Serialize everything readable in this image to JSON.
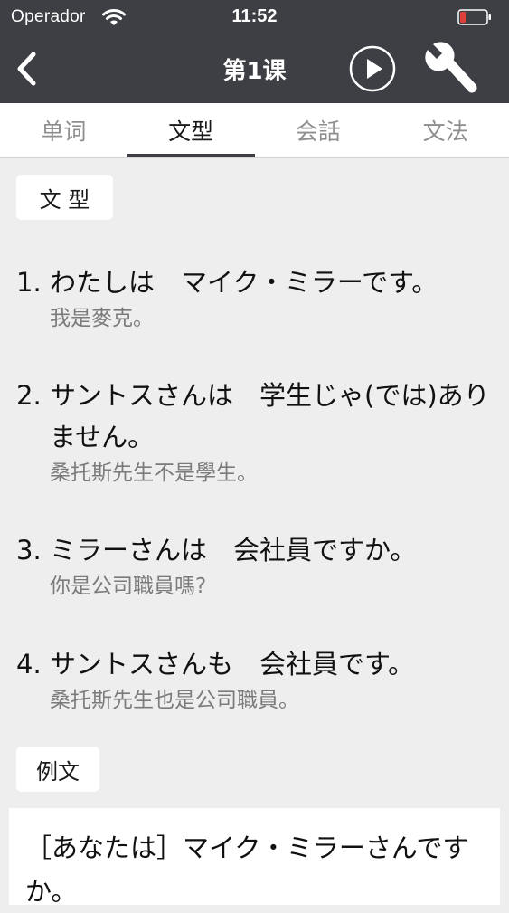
{
  "status_bar": {
    "carrier": "Operador",
    "time": "11:52",
    "battery_color": "#e0403a"
  },
  "nav": {
    "title": "第1课",
    "back_icon": "chevron-left-icon",
    "play_icon": "play-circle-icon",
    "settings_icon": "wrench-icon"
  },
  "tabs": [
    {
      "label": "单词",
      "active": false
    },
    {
      "label": "文型",
      "active": true
    },
    {
      "label": "会話",
      "active": false
    },
    {
      "label": "文法",
      "active": false
    }
  ],
  "section": {
    "label": "文 型"
  },
  "sentences": [
    {
      "number": "1.",
      "jp": "わたしは　マイク・ミラーです。",
      "zh": "我是麥克。"
    },
    {
      "number": "2.",
      "jp": "サントスさんは　学生じゃ(では)ありません。",
      "zh": "桑托斯先生不是學生。"
    },
    {
      "number": "3.",
      "jp": "ミラーさんは　会社員ですか。",
      "zh": "你是公司職員嗎?"
    },
    {
      "number": "4.",
      "jp": "サントスさんも　会社員です。",
      "zh": "桑托斯先生也是公司職員。"
    }
  ],
  "example": {
    "label": "例文",
    "text": "［あなたは］マイク・ミラーさんですか。"
  },
  "colors": {
    "bar_background": "#3d3f44",
    "content_background": "#efeeee",
    "secondary_text": "#7b7b7b"
  }
}
